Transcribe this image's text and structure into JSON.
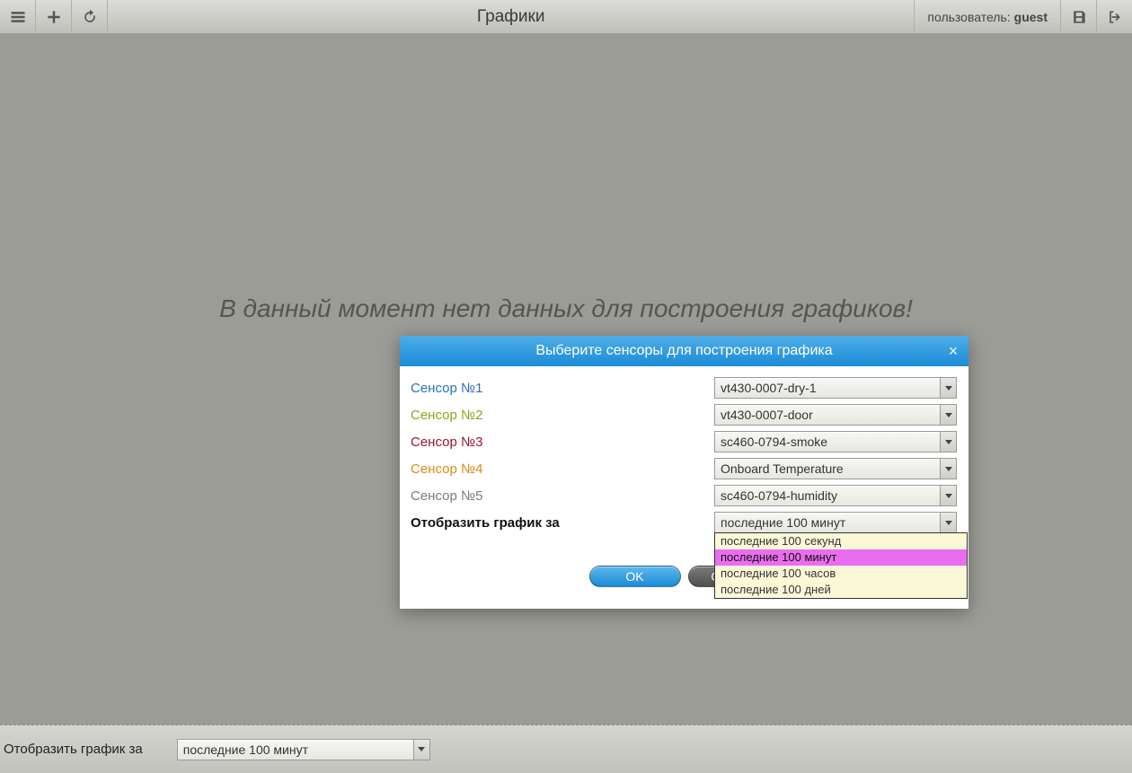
{
  "header": {
    "title": "Графики",
    "user_prefix": "пользователь:",
    "user_name": "guest"
  },
  "main": {
    "no_data": "В данный момент нет данных для построения графиков!"
  },
  "bottom": {
    "label": "Отобразить график за",
    "value": "последние 100 минут"
  },
  "dialog": {
    "title": "Выберите сенсоры для построения графика",
    "sensors": [
      {
        "label": "Сенсор №1",
        "value": "vt430-0007-dry-1"
      },
      {
        "label": "Сенсор №2",
        "value": "vt430-0007-door"
      },
      {
        "label": "Сенсор №3",
        "value": "sc460-0794-smoke"
      },
      {
        "label": "Сенсор №4",
        "value": "Onboard Temperature"
      },
      {
        "label": "Сенсор №5",
        "value": "sc460-0794-humidity"
      }
    ],
    "range_label": "Отобразить график за",
    "range_value": "последние 100 минут",
    "range_options": [
      "последние 100 секунд",
      "последние 100 минут",
      "последние 100 часов",
      "последние 100 дней"
    ],
    "ok": "OK",
    "cancel": "Отмена"
  }
}
